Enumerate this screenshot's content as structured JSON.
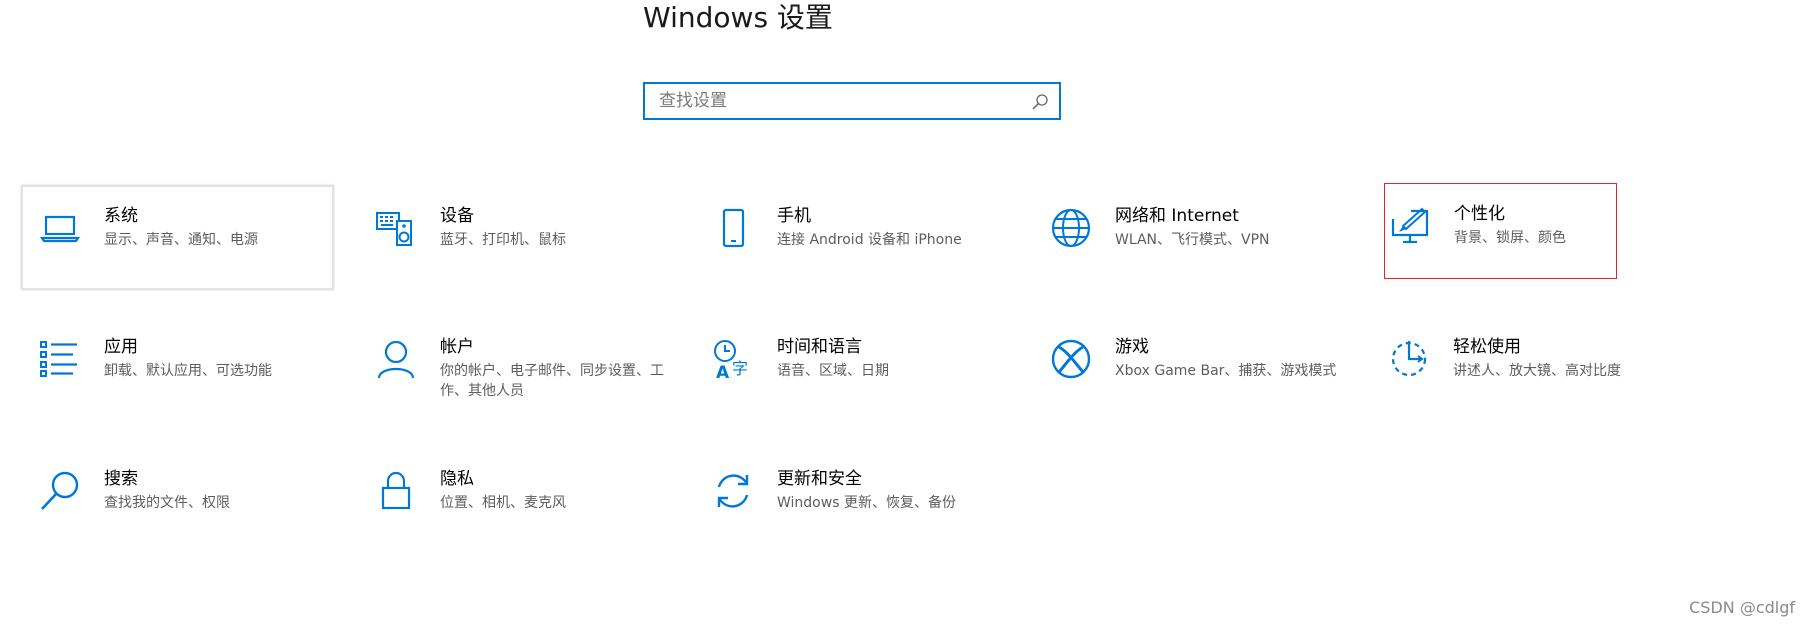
{
  "window": {
    "title": "Windows 设置"
  },
  "search": {
    "placeholder": "查找设置",
    "icon": "search-icon"
  },
  "accent_color": "#0078d7",
  "selection_color": "#e0262b",
  "categories": [
    {
      "id": "system",
      "name": "系统",
      "desc": "显示、声音、通知、电源",
      "icon": "laptop-icon"
    },
    {
      "id": "devices",
      "name": "设备",
      "desc": "蓝牙、打印机、鼠标",
      "icon": "keyboard-speaker-icon"
    },
    {
      "id": "phone",
      "name": "手机",
      "desc": "连接 Android 设备和 iPhone",
      "icon": "phone-icon"
    },
    {
      "id": "network",
      "name": "网络和 Internet",
      "desc": "WLAN、飞行模式、VPN",
      "icon": "globe-icon"
    },
    {
      "id": "personalization",
      "name": "个性化",
      "desc": "背景、锁屏、颜色",
      "icon": "paint-screen-icon"
    },
    {
      "id": "apps",
      "name": "应用",
      "desc": "卸载、默认应用、可选功能",
      "icon": "app-list-icon"
    },
    {
      "id": "accounts",
      "name": "帐户",
      "desc": "你的帐户、电子邮件、同步设置、工作、其他人员",
      "icon": "person-icon"
    },
    {
      "id": "time-language",
      "name": "时间和语言",
      "desc": "语音、区域、日期",
      "icon": "clock-language-icon"
    },
    {
      "id": "gaming",
      "name": "游戏",
      "desc": "Xbox Game Bar、捕获、游戏模式",
      "icon": "xbox-icon"
    },
    {
      "id": "ease-of-access",
      "name": "轻松使用",
      "desc": "讲述人、放大镜、高对比度",
      "icon": "accessibility-icon"
    },
    {
      "id": "search",
      "name": "搜索",
      "desc": "查找我的文件、权限",
      "icon": "magnifier-icon"
    },
    {
      "id": "privacy",
      "name": "隐私",
      "desc": "位置、相机、麦克风",
      "icon": "lock-icon"
    },
    {
      "id": "update-security",
      "name": "更新和安全",
      "desc": "Windows 更新、恢复、备份",
      "icon": "refresh-icon"
    }
  ],
  "watermark": "CSDN @cdlgf"
}
